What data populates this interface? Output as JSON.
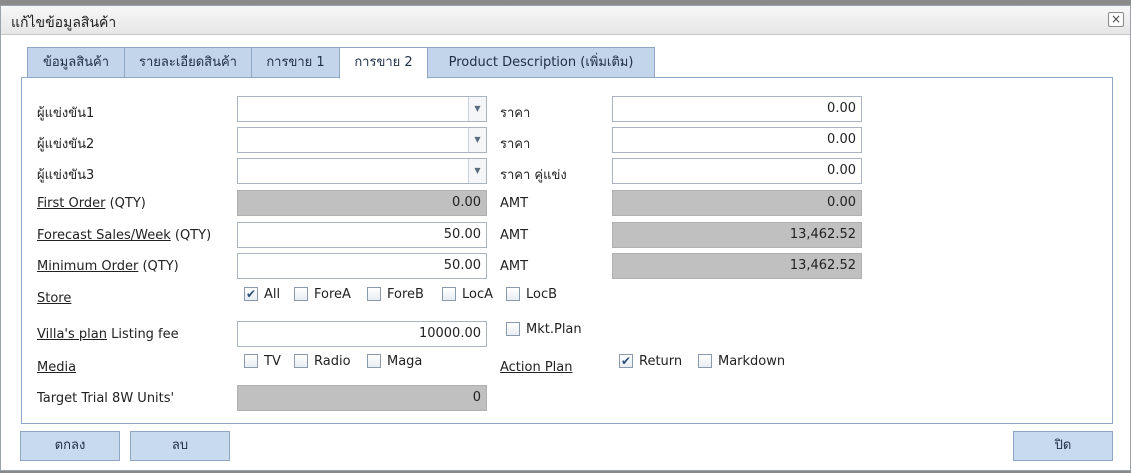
{
  "dialog": {
    "title": "แก้ไขข้อมูลสินค้า",
    "close_icon": "×"
  },
  "tabs": [
    {
      "label": "ข้อมูลสินค้า"
    },
    {
      "label": "รายละเอียดสินค้า"
    },
    {
      "label": "การขาย 1"
    },
    {
      "label": "การขาย 2"
    },
    {
      "label": "Product Description (เพิ่มเติม)"
    }
  ],
  "active_tab": "การขาย 2",
  "competitors": [
    {
      "label": "ผู้แข่งขัน1",
      "value": "",
      "price_label": "ราคา",
      "price": "0.00"
    },
    {
      "label": "ผู้แข่งขัน2",
      "value": "",
      "price_label": "ราคา",
      "price": "0.00"
    },
    {
      "label": "ผู้แข่งขัน3",
      "value": "",
      "price_label": "ราคา คู่แข่ง",
      "price": "0.00"
    }
  ],
  "orders": [
    {
      "label_u": "First Order",
      "label_rest": " (QTY)",
      "qty": "0.00",
      "amt_label": "AMT",
      "amt": "0.00"
    },
    {
      "label_u": "Forecast Sales/Week",
      "label_rest": " (QTY)",
      "qty": "50.00",
      "amt_label": "AMT",
      "amt": "13,462.52"
    },
    {
      "label_u": "Minimum Order",
      "label_rest": " (QTY)",
      "qty": "50.00",
      "amt_label": "AMT",
      "amt": "13,462.52"
    }
  ],
  "store": {
    "label": "Store",
    "options": [
      {
        "label": "All",
        "checked": true
      },
      {
        "label": "ForeA",
        "checked": false
      },
      {
        "label": "ForeB",
        "checked": false
      },
      {
        "label": "LocA",
        "checked": false
      },
      {
        "label": "LocB",
        "checked": false
      }
    ]
  },
  "villas_plan": {
    "label_u": "Villa's plan",
    "label_rest": " Listing fee",
    "value": "10000.00",
    "mkt_plan": {
      "label": "Mkt.Plan",
      "checked": false
    }
  },
  "media": {
    "label": "Media",
    "options": [
      {
        "label": "TV",
        "checked": false
      },
      {
        "label": "Radio",
        "checked": false
      },
      {
        "label": "Maga",
        "checked": false
      }
    ]
  },
  "action_plan": {
    "label": "Action Plan",
    "options": [
      {
        "label": "Return",
        "checked": true
      },
      {
        "label": "Markdown",
        "checked": false
      }
    ]
  },
  "target_trial": {
    "label": "Target Trial 8W Units'",
    "value": "0"
  },
  "buttons": {
    "ok": "ตกลง",
    "delete": "ลบ",
    "close": "ปิด"
  },
  "icons": {
    "dropdown": "▼",
    "check": "✔"
  }
}
